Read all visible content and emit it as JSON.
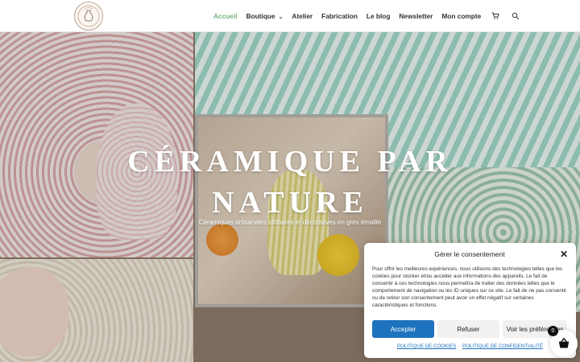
{
  "brand": {
    "logo_icon": "pottery-logo-icon"
  },
  "nav": {
    "items": [
      {
        "label": "Accueil",
        "active": true
      },
      {
        "label": "Boutique",
        "has_dropdown": true
      },
      {
        "label": "Atelier"
      },
      {
        "label": "Fabrication"
      },
      {
        "label": "Le blog"
      },
      {
        "label": "Newsletter"
      },
      {
        "label": "Mon compte"
      }
    ],
    "cart_icon": "cart-icon",
    "search_icon": "search-icon",
    "active_color": "#7bb27a"
  },
  "hero": {
    "title_line1": "CÉRAMIQUE PAR",
    "title_line2": "NATURE",
    "subtitle": "Céramiques artisanales utilitaires et décoratives en grès émaillé"
  },
  "consent": {
    "title": "Gérer le consentement",
    "text": "Pour offrir les meilleures expériences, nous utilisons des technologies telles que les cookies pour stocker et/ou accéder aux informations des appareils. Le fait de consentir à ces technologies nous permettra de traiter des données telles que le comportement de navigation ou les ID uniques sur ce site. Le fait de ne pas consentir ou de retirer son consentement peut avoir un effet négatif sur certaines caractéristiques et fonctions.",
    "accept": "Accepter",
    "refuse": "Refuser",
    "prefs": "Voir les préférences",
    "link_cookies": "POLITIQUE DE COOKIES",
    "link_privacy": "POLITIQUE DE CONFIDENTIALITÉ"
  },
  "floating_cart": {
    "count": "0",
    "icon": "basket-icon"
  }
}
